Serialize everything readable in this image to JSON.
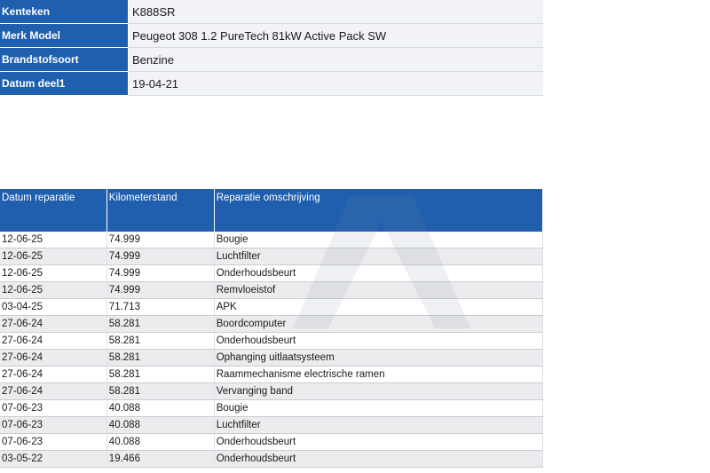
{
  "vehicle": {
    "rows": [
      {
        "label": "Kenteken",
        "value": "K888SR"
      },
      {
        "label": "Merk Model",
        "value": "Peugeot 308 1.2 PureTech 81kW Active Pack SW"
      },
      {
        "label": "Brandstofsoort",
        "value": "Benzine"
      },
      {
        "label": "Datum deel1",
        "value": "19-04-21"
      }
    ]
  },
  "repairs": {
    "headers": [
      "Datum reparatie",
      "Kilometerstand",
      "Reparatie omschrijving"
    ],
    "rows": [
      [
        "12-06-25",
        "74.999",
        "Bougie"
      ],
      [
        "12-06-25",
        "74.999",
        "Luchtfilter"
      ],
      [
        "12-06-25",
        "74.999",
        "Onderhoudsbeurt"
      ],
      [
        "12-06-25",
        "74.999",
        "Remvloeistof"
      ],
      [
        "03-04-25",
        "71.713",
        "APK"
      ],
      [
        "27-06-24",
        "58.281",
        "Boordcomputer"
      ],
      [
        "27-06-24",
        "58.281",
        "Onderhoudsbeurt"
      ],
      [
        "27-06-24",
        "58.281",
        "Ophanging uitlaatsysteem"
      ],
      [
        "27-06-24",
        "58.281",
        "Raammechanisme electrische ramen"
      ],
      [
        "27-06-24",
        "58.281",
        "Vervanging band"
      ],
      [
        "07-06-23",
        "40.088",
        "Bougie"
      ],
      [
        "07-06-23",
        "40.088",
        "Luchtfilter"
      ],
      [
        "07-06-23",
        "40.088",
        "Onderhoudsbeurt"
      ],
      [
        "03-05-22",
        "19.466",
        "Onderhoudsbeurt"
      ]
    ]
  },
  "colors": {
    "header_blue": "#1f5fae",
    "row_alt": "#ececee"
  }
}
